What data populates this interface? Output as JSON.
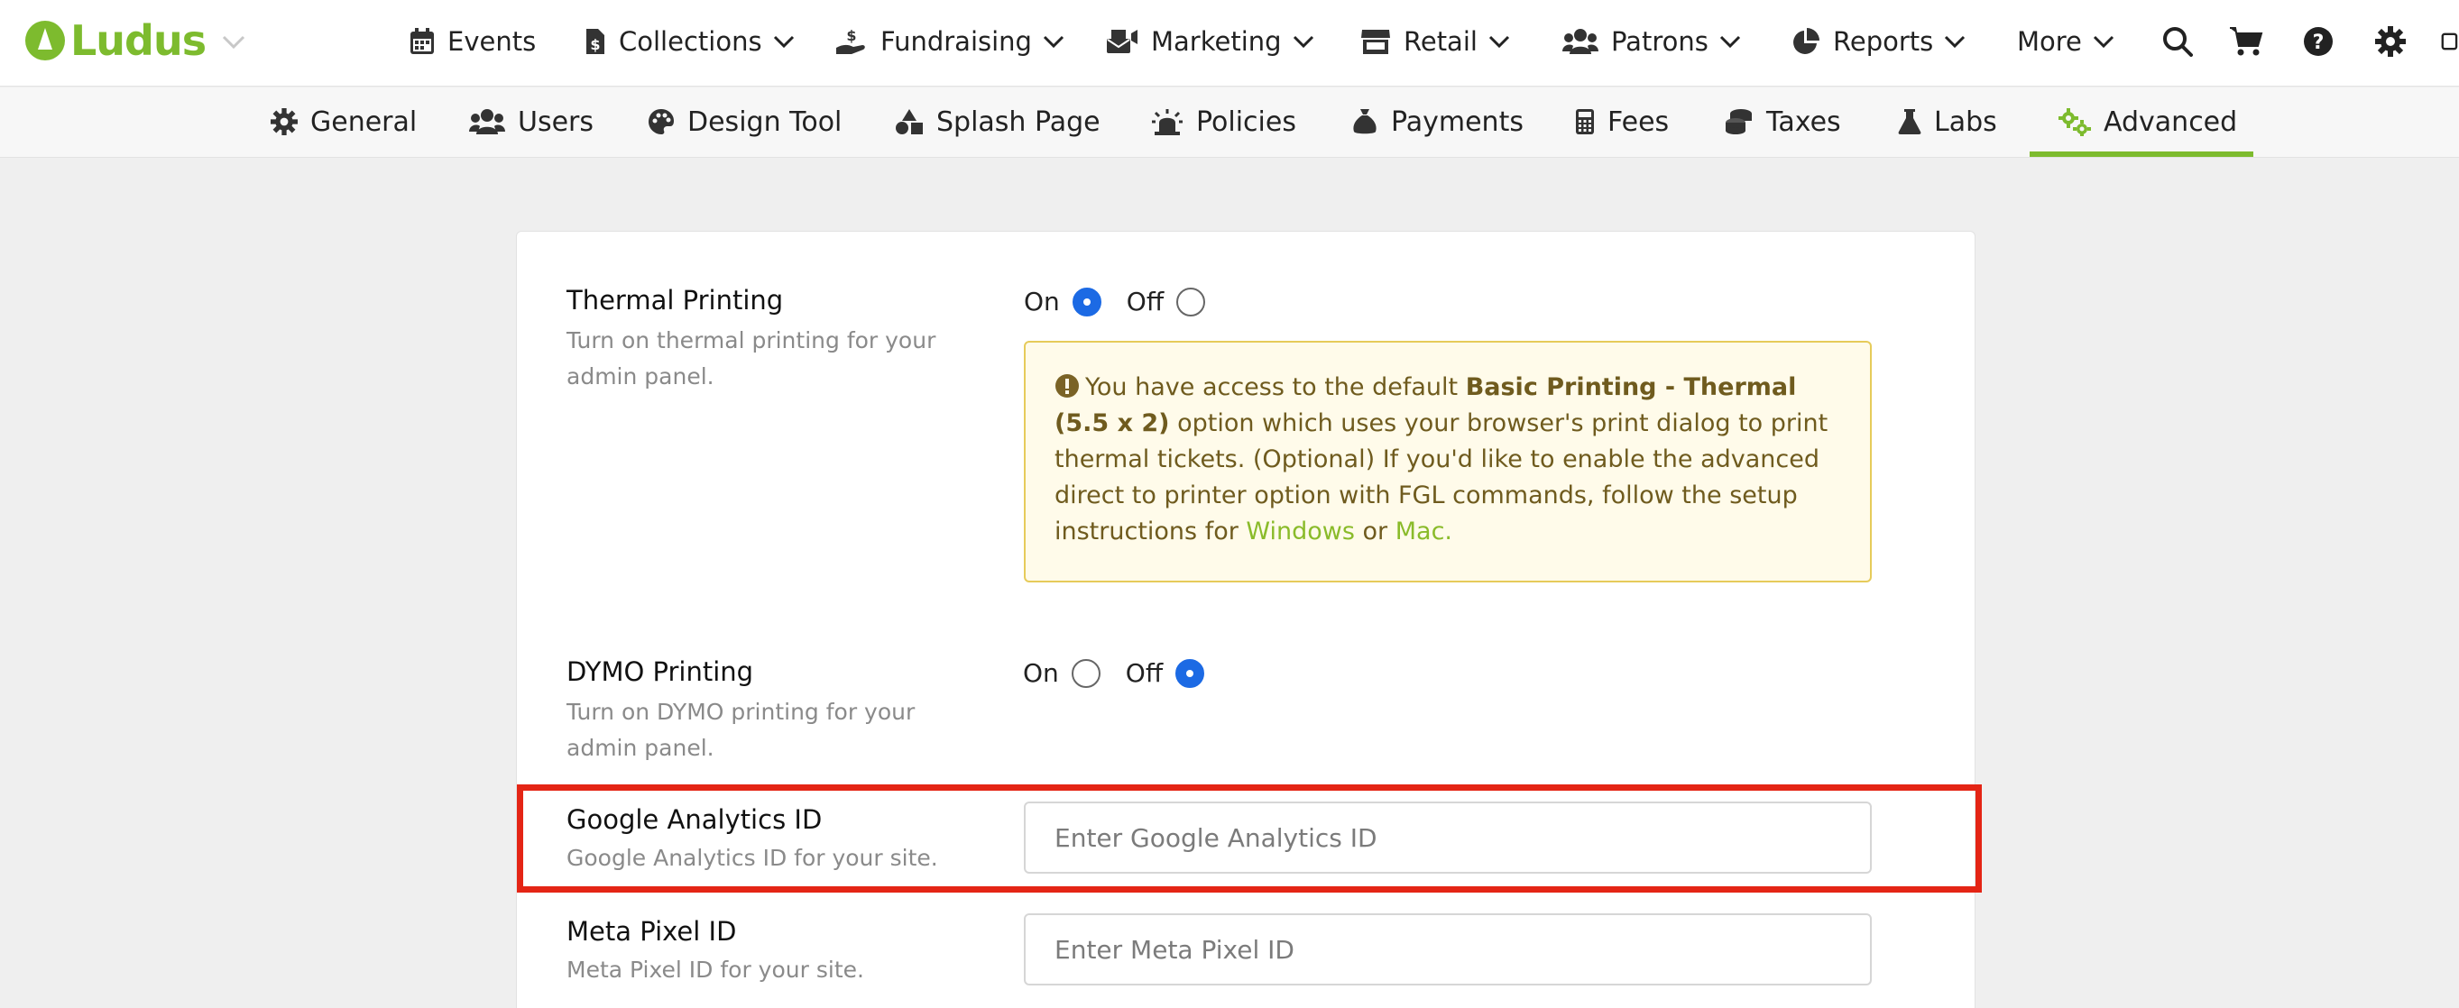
{
  "app": {
    "brand": "Ludus",
    "accent": "#7dbb2e"
  },
  "topnav": {
    "items": [
      {
        "label": "Events",
        "icon": "calendar-icon"
      },
      {
        "label": "Collections",
        "icon": "file-dollar-icon"
      },
      {
        "label": "Fundraising",
        "icon": "hand-dollar-icon"
      },
      {
        "label": "Marketing",
        "icon": "mail-bullhorn-icon"
      },
      {
        "label": "Retail",
        "icon": "store-icon"
      },
      {
        "label": "Patrons",
        "icon": "users-icon"
      },
      {
        "label": "Reports",
        "icon": "pie-chart-icon"
      },
      {
        "label": "More",
        "icon": ""
      }
    ],
    "tools": [
      "search-icon",
      "cart-icon",
      "help-icon",
      "gear-icon",
      "account-icon"
    ]
  },
  "subnav": {
    "items": [
      {
        "label": "General",
        "icon": "gear-icon"
      },
      {
        "label": "Users",
        "icon": "users-icon"
      },
      {
        "label": "Design Tool",
        "icon": "palette-icon"
      },
      {
        "label": "Splash Page",
        "icon": "shapes-icon"
      },
      {
        "label": "Policies",
        "icon": "siren-icon"
      },
      {
        "label": "Payments",
        "icon": "money-bag-icon"
      },
      {
        "label": "Fees",
        "icon": "calculator-icon"
      },
      {
        "label": "Taxes",
        "icon": "coins-icon"
      },
      {
        "label": "Labs",
        "icon": "flask-icon"
      },
      {
        "label": "Advanced",
        "icon": "gears-icon"
      }
    ],
    "active": "Advanced"
  },
  "settings": {
    "thermal": {
      "label": "Thermal Printing",
      "description": "Turn on thermal printing for your admin panel.",
      "on_label": "On",
      "off_label": "Off",
      "selected": "On",
      "alert": {
        "text1": "You have access to the default ",
        "bold": "Basic Printing - Thermal (5.5 x 2)",
        "text2": " option which uses your browser's print dialog to print thermal tickets. (Optional) If you'd like to enable the advanced direct to printer option with FGL commands, follow the setup instructions for ",
        "link1": "Windows",
        "text3": " or ",
        "link2": "Mac."
      }
    },
    "dymo": {
      "label": "DYMO Printing",
      "description": "Turn on DYMO printing for your admin panel.",
      "on_label": "On",
      "off_label": "Off",
      "selected": "Off"
    },
    "google_analytics": {
      "label": "Google Analytics ID",
      "description": "Google Analytics ID for your site.",
      "placeholder": "Enter Google Analytics ID",
      "value": ""
    },
    "meta_pixel": {
      "label": "Meta Pixel ID",
      "description": "Meta Pixel ID for your site.",
      "placeholder": "Enter Meta Pixel ID",
      "value": ""
    }
  }
}
